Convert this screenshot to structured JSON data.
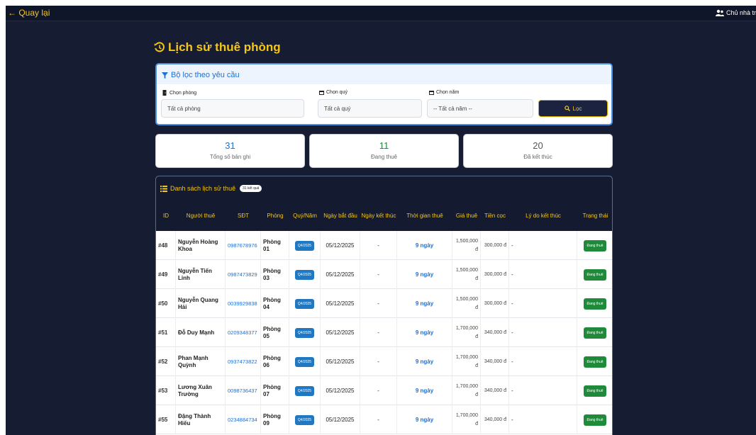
{
  "topbar": {
    "back_label": "← Quay lại",
    "owner_label": "Chủ nhà tr"
  },
  "page_title": "Lịch sử thuê phòng",
  "filter": {
    "title": "Bộ lọc theo yêu cầu",
    "room_label": "Chọn phòng",
    "room_value": "Tất cả phòng",
    "quarter_label": "Chọn quý",
    "quarter_value": "Tất cả quý",
    "year_label": "Chọn năm",
    "year_value": "-- Tất cả năm --",
    "button_label": "Lọc"
  },
  "stats": [
    {
      "value": "31",
      "label": "Tổng số bản ghi"
    },
    {
      "value": "11",
      "label": "Đang thuê"
    },
    {
      "value": "20",
      "label": "Đã kết thúc"
    }
  ],
  "list": {
    "title": "Danh sách lịch sử thuê",
    "count_badge": "31 kết quả",
    "headers": [
      "ID",
      "Người thuê",
      "SĐT",
      "Phòng",
      "Quý/Năm",
      "Ngày bắt đầu",
      "Ngày kết thúc",
      "Thời gian thuê",
      "Giá thuê",
      "Tiền cọc",
      "Lý do kết thúc",
      "Trạng thái"
    ],
    "rows": [
      {
        "id": "#48",
        "name": "Nguyễn Hoàng Khoa",
        "phone": "0987678976",
        "room": "Phòng 01",
        "quarter": "Q4/2025",
        "start": "05/12/2025",
        "end": "-",
        "duration": "9 ngày",
        "price": "1,500,000 đ",
        "deposit": "300,000 đ",
        "reason": "-",
        "status": "Đang thuê"
      },
      {
        "id": "#49",
        "name": "Nguyễn Tiến Linh",
        "phone": "0987473829",
        "room": "Phòng 03",
        "quarter": "Q4/2025",
        "start": "05/12/2025",
        "end": "-",
        "duration": "9 ngày",
        "price": "1,500,000 đ",
        "deposit": "300,000 đ",
        "reason": "-",
        "status": "Đang thuê"
      },
      {
        "id": "#50",
        "name": "Nguyễn Quang Hải",
        "phone": "0039929838",
        "room": "Phòng 04",
        "quarter": "Q4/2025",
        "start": "05/12/2025",
        "end": "-",
        "duration": "9 ngày",
        "price": "1,500,000 đ",
        "deposit": "300,000 đ",
        "reason": "-",
        "status": "Đang thuê"
      },
      {
        "id": "#51",
        "name": "Đỗ Duy Mạnh",
        "phone": "0209348377",
        "room": "Phòng 05",
        "quarter": "Q4/2025",
        "start": "05/12/2025",
        "end": "-",
        "duration": "9 ngày",
        "price": "1,700,000 đ",
        "deposit": "340,000 đ",
        "reason": "-",
        "status": "Đang thuê"
      },
      {
        "id": "#52",
        "name": "Phan Mạnh Quỳnh",
        "phone": "0937473822",
        "room": "Phòng 06",
        "quarter": "Q4/2025",
        "start": "05/12/2025",
        "end": "-",
        "duration": "9 ngày",
        "price": "1,700,000 đ",
        "deposit": "340,000 đ",
        "reason": "-",
        "status": "Đang thuê"
      },
      {
        "id": "#53",
        "name": "Lương Xuân Trường",
        "phone": "0098736437",
        "room": "Phòng 07",
        "quarter": "Q4/2025",
        "start": "05/12/2025",
        "end": "-",
        "duration": "9 ngày",
        "price": "1,700,000 đ",
        "deposit": "340,000 đ",
        "reason": "-",
        "status": "Đang thuê"
      },
      {
        "id": "#55",
        "name": "Đặng Thành Hiếu",
        "phone": "0234884734",
        "room": "Phòng 09",
        "quarter": "Q4/2025",
        "start": "05/12/2025",
        "end": "-",
        "duration": "9 ngày",
        "price": "1,700,000 đ",
        "deposit": "340,000 đ",
        "reason": "-",
        "status": "Đang thuê"
      }
    ]
  },
  "colors": {
    "accent": "#f5c518",
    "link": "#1f6fd1",
    "success": "#1f8a3a",
    "dark_bg": "#161d33"
  },
  "icons": {
    "title": "history-icon",
    "filter": "funnel-icon",
    "room": "door-icon",
    "calendar": "calendar-icon",
    "search": "search-icon",
    "list": "list-icon",
    "owner": "user-group-icon"
  }
}
